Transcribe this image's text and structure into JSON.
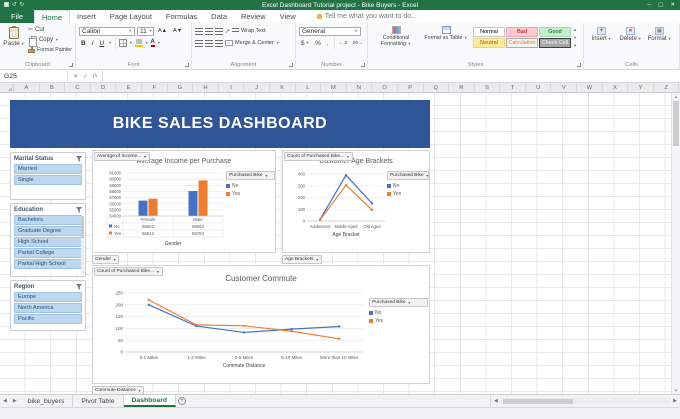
{
  "window": {
    "title": "Excel Dashboard Tutorial project - Bike Buyers - Excel"
  },
  "icons": {
    "dropdown": "▼",
    "prev": "◀",
    "next": "▶",
    "up": "▲",
    "down": "▼",
    "close": "✕",
    "minimize": "─",
    "maximize": "▢",
    "undo": "↺",
    "redo": "↻",
    "check": "✓",
    "cancel": "✕",
    "fx": "fx",
    "scissors": "✂",
    "plus": "+",
    "bold": "B",
    "italic": "I",
    "underline": "U",
    "dollar": "$",
    "percent": "%",
    "comma": ",",
    "increase_decimal": "←.0",
    "decrease_decimal": ".00→",
    "font_grow": "A▲",
    "font_shrink": "A▼",
    "font_a": "A",
    "orientation": "↗",
    "grid": "▦"
  },
  "ribbon": {
    "file_tab": "File",
    "active_tab": "Home",
    "tabs": [
      "Home",
      "Insert",
      "Page Layout",
      "Formulas",
      "Data",
      "Review",
      "View"
    ],
    "tell_me": "Tell me what you want to do...",
    "clipboard": {
      "label": "Clipboard",
      "paste": "Paste",
      "cut": "Cut",
      "copy": "Copy",
      "format_painter": "Format Painter"
    },
    "font": {
      "label": "Font",
      "family": "Calibri",
      "size": "11"
    },
    "alignment": {
      "label": "Alignment",
      "wrap_text": "Wrap Text",
      "merge_center": "Merge & Center"
    },
    "number": {
      "label": "Number",
      "format": "General"
    },
    "styles": {
      "label": "Styles",
      "conditional_formatting": "Conditional Formatting",
      "format_as_table": "Format as Table",
      "gallery": [
        "Normal",
        "Bad",
        "Good",
        "Neutral",
        "Calculation",
        "Check Cell"
      ]
    },
    "cells": {
      "label": "Cells",
      "insert": "Insert",
      "delete": "Delete",
      "format": "Format"
    }
  },
  "formula_bar": {
    "name_box": "G25"
  },
  "sheet": {
    "columns": [
      "A",
      "B",
      "C",
      "D",
      "E",
      "F",
      "G",
      "H",
      "I",
      "J",
      "K",
      "L",
      "M",
      "N",
      "O",
      "P",
      "Q",
      "R",
      "S",
      "T",
      "U",
      "V",
      "W",
      "X",
      "Y",
      "Z"
    ]
  },
  "dashboard": {
    "title": "BIKE SALES DASHBOARD",
    "slicers": [
      {
        "title": "Marital Status",
        "items": [
          "Married",
          "Single"
        ]
      },
      {
        "title": "Education",
        "items": [
          "Bachelors",
          "Graduate Degree",
          "High School",
          "Partial College",
          "Partial High School"
        ]
      },
      {
        "title": "Region",
        "items": [
          "Europe",
          "North America",
          "Pacific"
        ]
      }
    ]
  },
  "chart_data": [
    {
      "type": "bar",
      "title": "Average Income per Purchase",
      "field_button": "Average of Income...",
      "axis_field_button": "Gender",
      "legend_field_button": "Purchased Bike",
      "xlabel": "Gender",
      "categories": [
        "Female",
        "Male"
      ],
      "series": [
        {
          "name": "No",
          "color": "#4472C4",
          "values": [
            56502,
            58063
          ]
        },
        {
          "name": "Yes",
          "color": "#ED7D31",
          "values": [
            56812,
            59784
          ]
        }
      ],
      "ylim": [
        54000,
        61000
      ],
      "ytick": 1000,
      "data_table": true,
      "legend_position": "right",
      "grid": true
    },
    {
      "type": "line",
      "title": "Customer Age Brackets",
      "field_button": "Count of Purchased Bike...",
      "axis_field_button": "Age Brackets",
      "legend_field_button": "Purchased Bike",
      "xlabel": "Age Bracket",
      "categories": [
        "Adolescent",
        "Middle Aged",
        "Old Aged"
      ],
      "series": [
        {
          "name": "No",
          "color": "#4472C4",
          "values": [
            12,
            390,
            150
          ]
        },
        {
          "name": "Yes",
          "color": "#ED7D31",
          "values": [
            8,
            305,
            95
          ]
        }
      ],
      "ylim": [
        0,
        400
      ],
      "ytick": 100,
      "data_table": false,
      "legend_position": "right",
      "grid": true
    },
    {
      "type": "line",
      "title": "Customer Commute",
      "field_button": "Count of Purchased Bike...",
      "axis_field_button": "Commute Distance",
      "legend_field_button": "Purchased Bike",
      "xlabel": "Commute Distance",
      "categories": [
        "0-1 Miles",
        "1-2 Miles",
        "2-5 Miles",
        "5-10 Miles",
        "More than 10 Miles"
      ],
      "series": [
        {
          "name": "No",
          "color": "#4472C4",
          "values": [
            200,
            110,
            83,
            97,
            108
          ]
        },
        {
          "name": "Yes",
          "color": "#ED7D31",
          "values": [
            221,
            115,
            111,
            88,
            56
          ]
        }
      ],
      "ylim": [
        0,
        250
      ],
      "ytick": 50,
      "data_table": false,
      "legend_position": "right",
      "grid": true
    }
  ],
  "sheet_tabs": {
    "tabs": [
      "bike_buyers",
      "Pivot Table",
      "Dashboard"
    ],
    "active": "Dashboard"
  }
}
